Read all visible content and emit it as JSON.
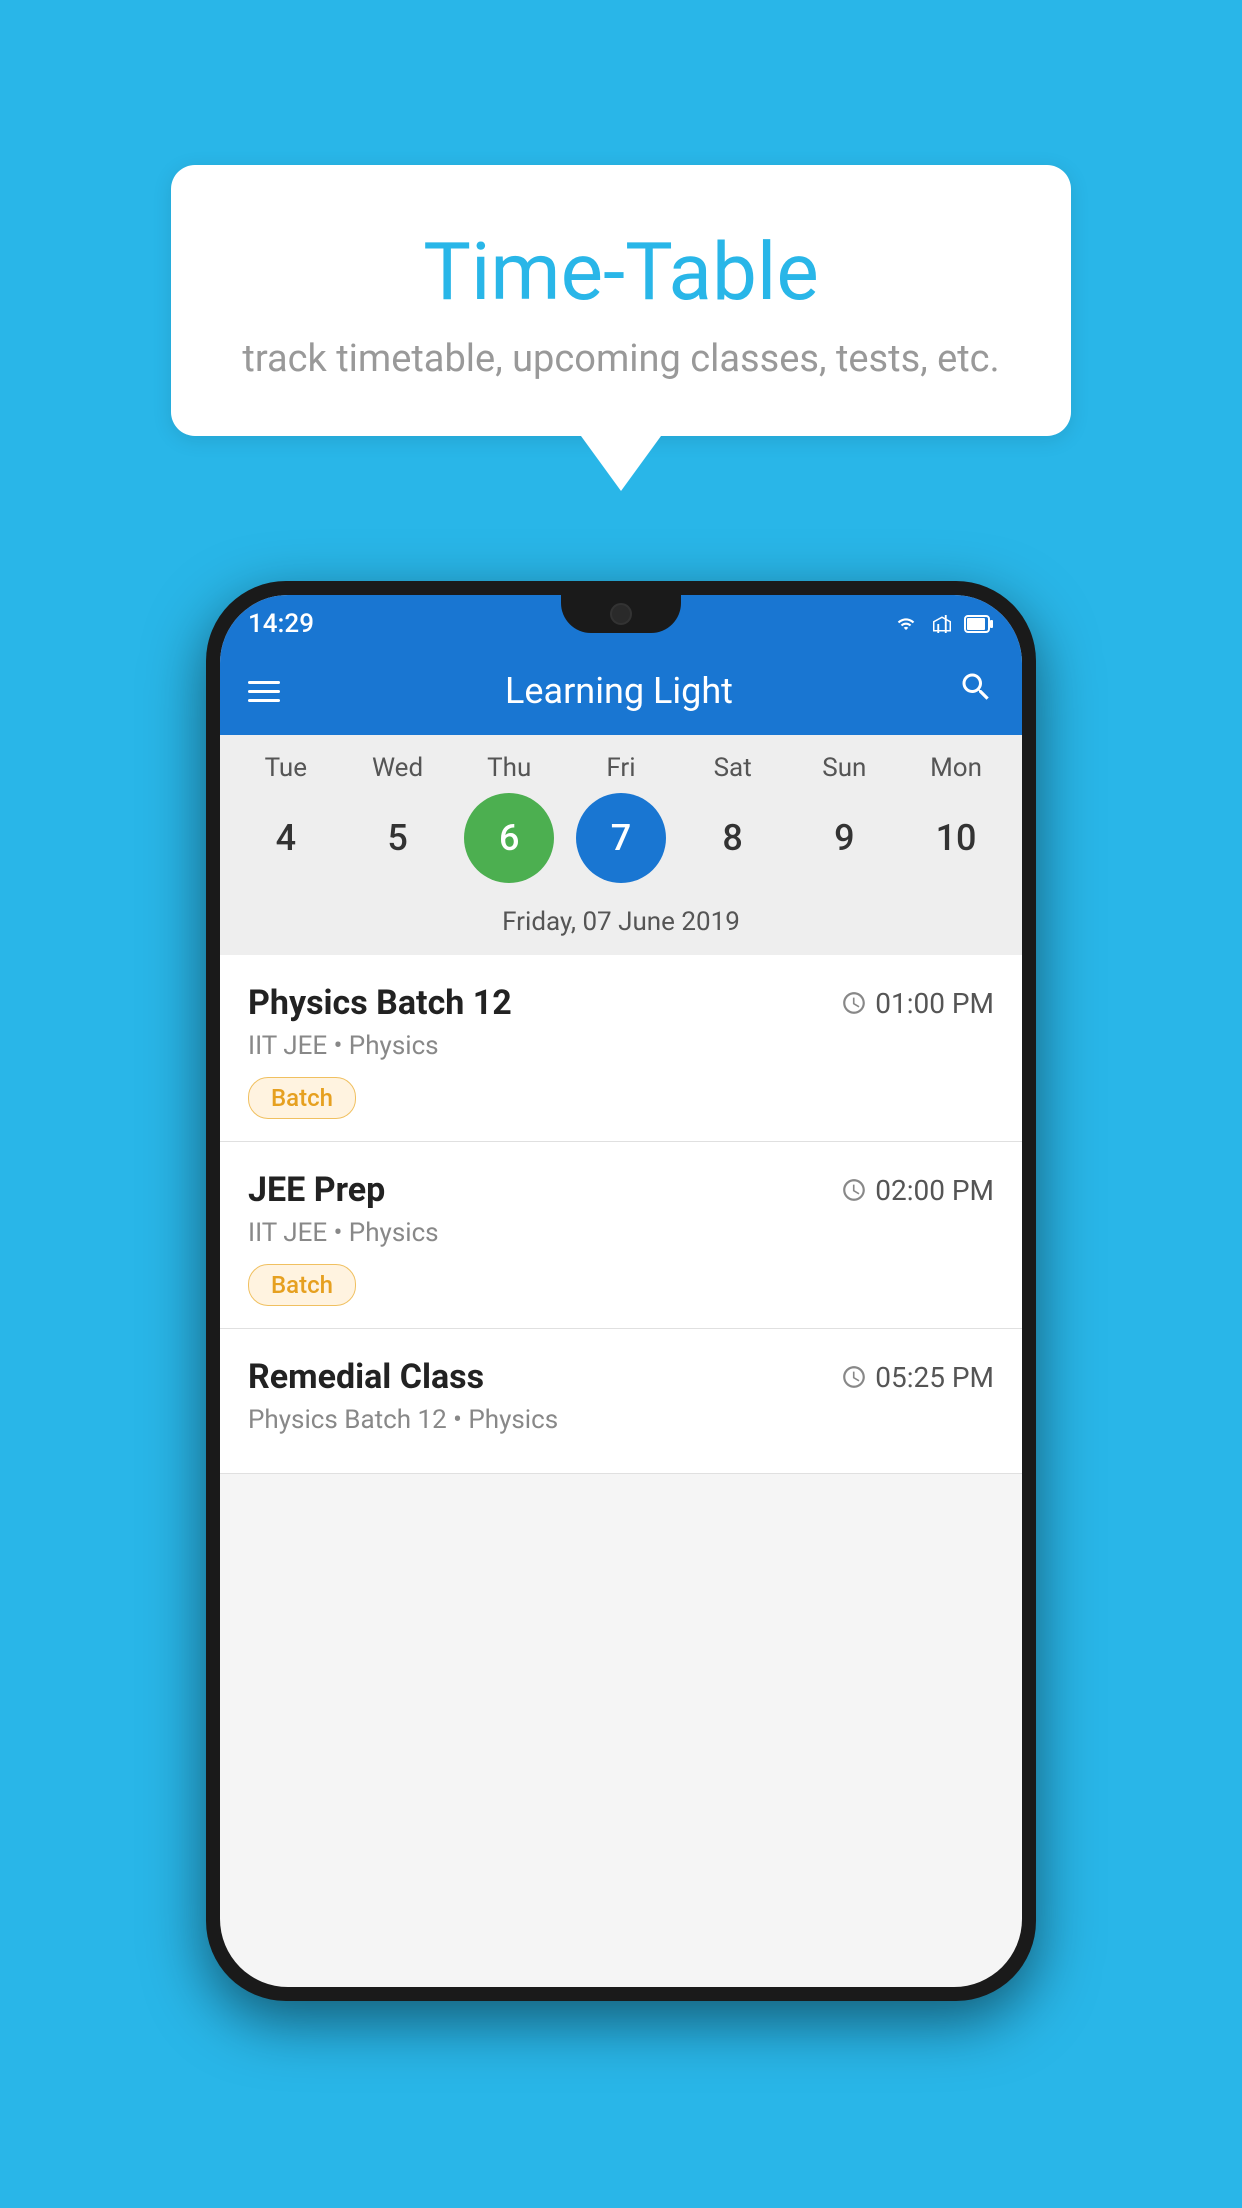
{
  "background_color": "#29b6e8",
  "speech_bubble": {
    "title": "Time-Table",
    "subtitle": "track timetable, upcoming classes, tests, etc."
  },
  "phone": {
    "status_bar": {
      "time": "14:29"
    },
    "app_bar": {
      "title": "Learning Light"
    },
    "calendar": {
      "days": [
        {
          "label": "Tue",
          "number": "4"
        },
        {
          "label": "Wed",
          "number": "5"
        },
        {
          "label": "Thu",
          "number": "6",
          "state": "today"
        },
        {
          "label": "Fri",
          "number": "7",
          "state": "selected"
        },
        {
          "label": "Sat",
          "number": "8"
        },
        {
          "label": "Sun",
          "number": "9"
        },
        {
          "label": "Mon",
          "number": "10"
        }
      ],
      "selected_date_label": "Friday, 07 June 2019"
    },
    "classes": [
      {
        "name": "Physics Batch 12",
        "time": "01:00 PM",
        "subject": "IIT JEE • Physics",
        "tag": "Batch"
      },
      {
        "name": "JEE Prep",
        "time": "02:00 PM",
        "subject": "IIT JEE • Physics",
        "tag": "Batch"
      },
      {
        "name": "Remedial Class",
        "time": "05:25 PM",
        "subject": "Physics Batch 12 • Physics",
        "tag": ""
      }
    ]
  },
  "icons": {
    "hamburger": "☰",
    "search": "🔍",
    "clock": "🕐"
  }
}
